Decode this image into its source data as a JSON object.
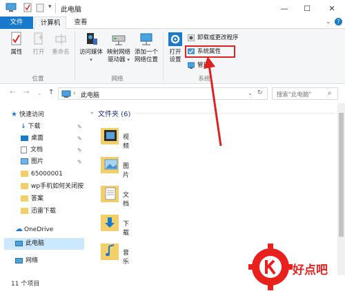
{
  "window": {
    "title": "此电脑",
    "buttons": {
      "minimize": "—",
      "maximize": "☐",
      "close": "✕"
    }
  },
  "tabs": {
    "file": "文件",
    "computer": "计算机",
    "view": "查看"
  },
  "ribbon": {
    "location_group": {
      "label": "位置",
      "properties": "属性",
      "open": "打开",
      "rename": "重命名"
    },
    "network_group": {
      "label": "网络",
      "access_media": "访问媒体",
      "map_drive_line1": "映射网络",
      "map_drive_line2": "驱动器",
      "add_location_line1": "添加一个",
      "add_location_line2": "网络位置"
    },
    "system_group": {
      "label": "系统",
      "open_settings_line1": "打开",
      "open_settings_line2": "设置",
      "uninstall": "卸载或更改程序",
      "system_properties": "系统属性",
      "manage": "管理"
    }
  },
  "address": {
    "path": "此电脑",
    "search_placeholder": "搜索\"此电脑\""
  },
  "nav": {
    "quick_access": "快速访问",
    "items": [
      "下载",
      "桌面",
      "文档",
      "图片",
      "65000001",
      "wp手机如何关闭按",
      "答案",
      "迅雷下载"
    ],
    "onedrive": "OneDrive",
    "this_pc": "此电脑",
    "network": "网络"
  },
  "content": {
    "group_header": "文件夹 (6)",
    "folders": [
      "视频",
      "图片",
      "文档",
      "下载",
      "音乐"
    ]
  },
  "status": {
    "item_count": "11 个项目"
  },
  "watermark": {
    "text": "好点吧"
  },
  "colors": {
    "accent": "#1979ca",
    "highlight": "#e0201e",
    "selected": "#cce8ff"
  }
}
